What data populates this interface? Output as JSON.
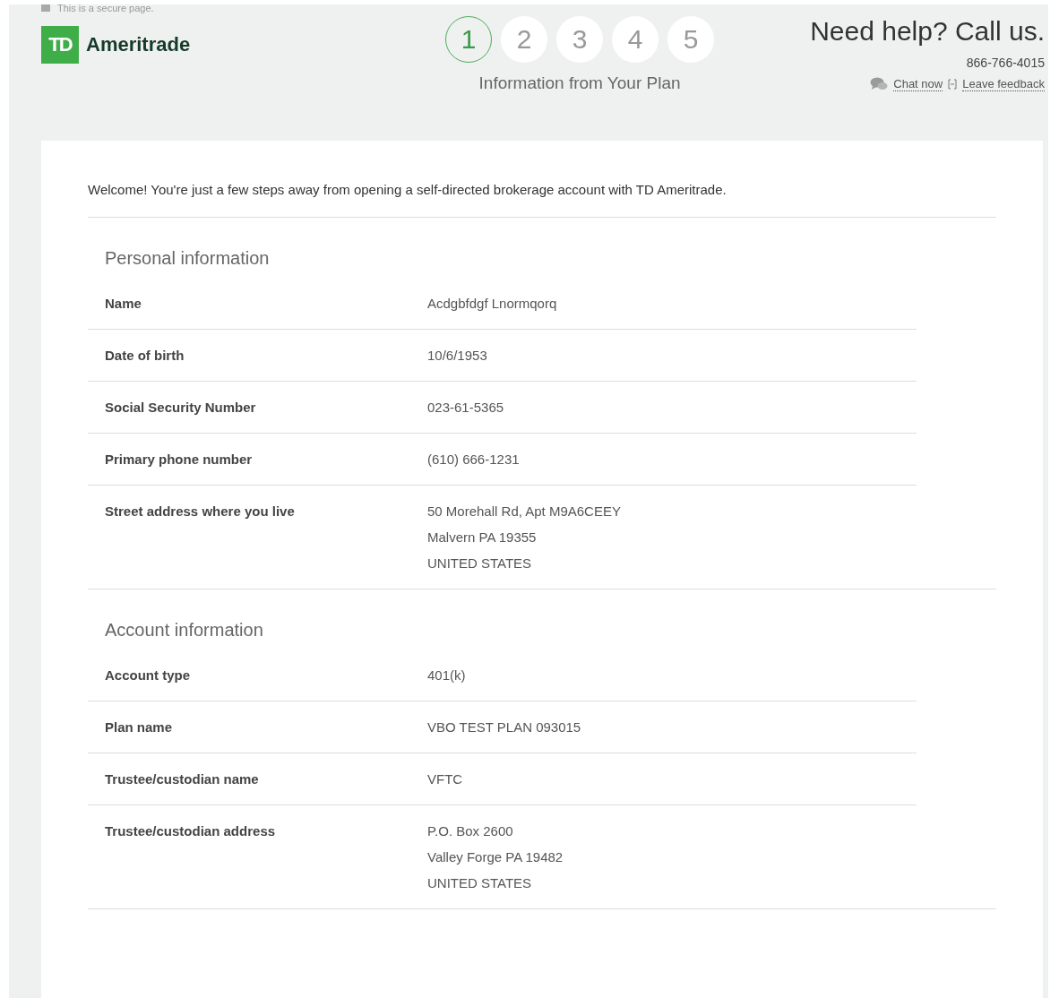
{
  "header": {
    "secure_note": "This is a secure page.",
    "logo": {
      "mark": "TD",
      "name": "Ameritrade"
    },
    "steps": [
      {
        "label": "1",
        "selected": true
      },
      {
        "label": "2",
        "selected": false
      },
      {
        "label": "3",
        "selected": false
      },
      {
        "label": "4",
        "selected": false
      },
      {
        "label": "5",
        "selected": false
      }
    ],
    "step_title": "Information from Your Plan",
    "help": {
      "title": "Need help? Call us.",
      "phone": "866-766-4015",
      "chat": "Chat now",
      "feedback": "Leave feedback"
    }
  },
  "welcome": "Welcome! You're just a few steps away from opening a self-directed brokerage account with TD Ameritrade.",
  "sections": [
    {
      "title": "Personal information",
      "rows": [
        {
          "label": "Name",
          "value": [
            "Acdgbfdgf Lnormqorq"
          ]
        },
        {
          "label": "Date of birth",
          "value": [
            "10/6/1953"
          ]
        },
        {
          "label": "Social Security Number",
          "value": [
            "023-61-5365"
          ]
        },
        {
          "label": "Primary phone number",
          "value": [
            "(610) 666-1231"
          ]
        },
        {
          "label": "Street address where you live",
          "value": [
            "50 Morehall Rd, Apt M9A6CEEY",
            "Malvern PA 19355",
            "UNITED STATES"
          ]
        }
      ]
    },
    {
      "title": "Account information",
      "rows": [
        {
          "label": "Account type",
          "value": [
            "401(k)"
          ]
        },
        {
          "label": "Plan name",
          "value": [
            "VBO TEST PLAN 093015"
          ]
        },
        {
          "label": "Trustee/custodian name",
          "value": [
            "VFTC"
          ]
        },
        {
          "label": "Trustee/custodian address",
          "value": [
            "P.O. Box 2600",
            "Valley Forge PA 19482",
            "UNITED STATES"
          ]
        }
      ]
    }
  ]
}
